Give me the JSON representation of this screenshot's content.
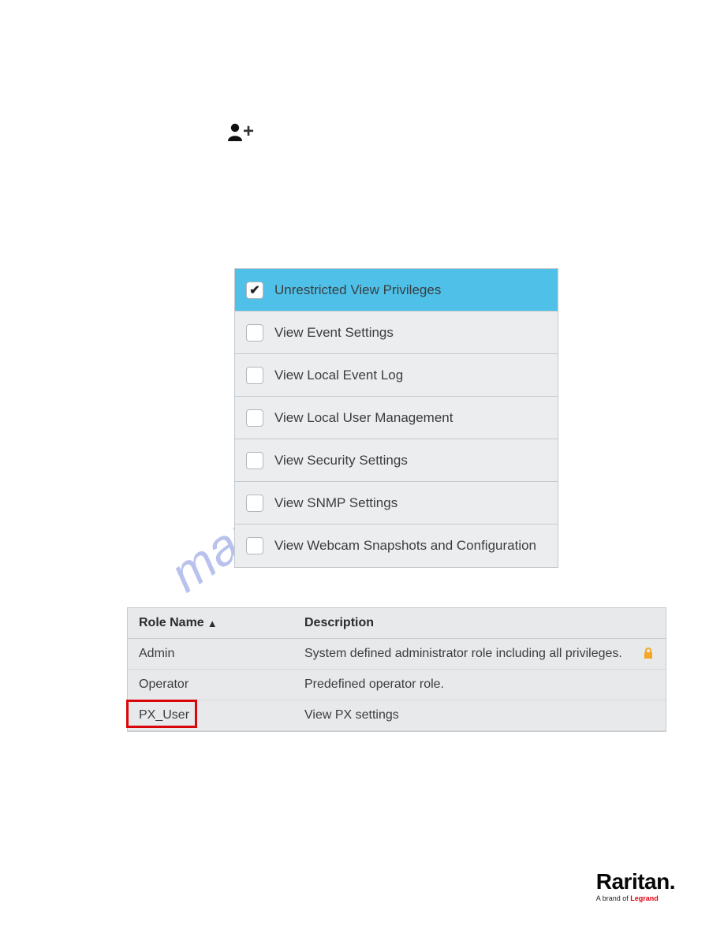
{
  "watermark_text": "manualshive.com",
  "privileges": {
    "items": [
      {
        "label": "Unrestricted View Privileges",
        "checked": true
      },
      {
        "label": "View Event Settings",
        "checked": false
      },
      {
        "label": "View Local Event Log",
        "checked": false
      },
      {
        "label": "View Local User Management",
        "checked": false
      },
      {
        "label": "View Security Settings",
        "checked": false
      },
      {
        "label": "View SNMP Settings",
        "checked": false
      },
      {
        "label": "View Webcam Snapshots and Configuration",
        "checked": false
      }
    ]
  },
  "roles": {
    "headers": {
      "name": "Role Name",
      "sort_glyph": "▲",
      "description": "Description"
    },
    "rows": [
      {
        "name": "Admin",
        "description": "System defined administrator role including all privileges.",
        "locked": true
      },
      {
        "name": "Operator",
        "description": "Predefined operator role.",
        "locked": false
      },
      {
        "name": "PX_User",
        "description": "View PX settings",
        "locked": false,
        "highlighted": true
      }
    ]
  },
  "brand": {
    "name": "Raritan.",
    "tag_prefix": "A brand of ",
    "tag_red": "Legrand"
  }
}
